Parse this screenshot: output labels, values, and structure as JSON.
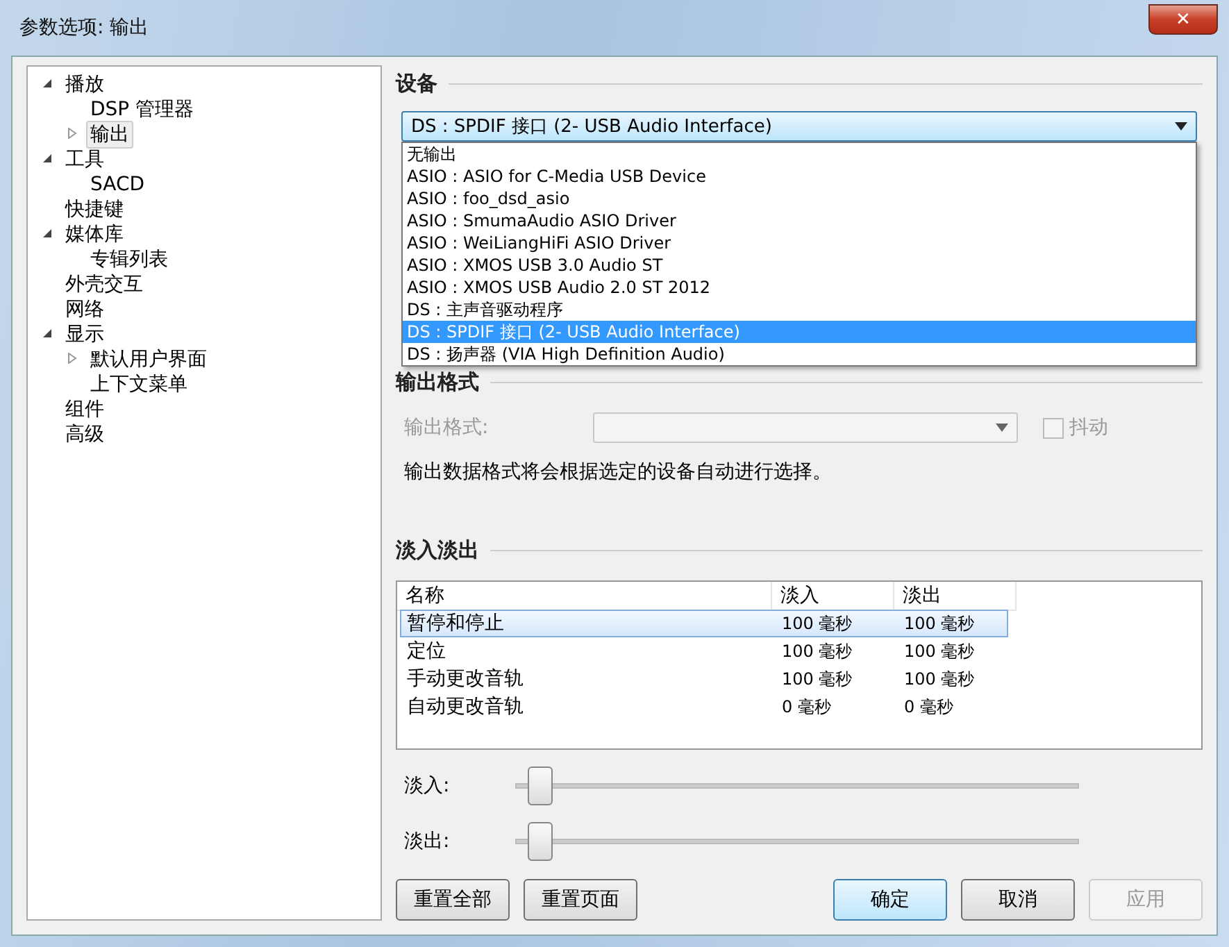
{
  "window": {
    "title": "参数选项: 输出",
    "close": "✕"
  },
  "tree": [
    {
      "label": "播放",
      "expanded": true,
      "selected": false,
      "children": [
        {
          "label": "DSP 管理器",
          "selected": false
        },
        {
          "label": "输出",
          "expanded": false,
          "selected": true
        }
      ]
    },
    {
      "label": "工具",
      "expanded": true,
      "selected": false,
      "children": [
        {
          "label": "SACD",
          "selected": false
        }
      ]
    },
    {
      "label": "快捷键",
      "selected": false
    },
    {
      "label": "媒体库",
      "expanded": true,
      "selected": false,
      "children": [
        {
          "label": "专辑列表",
          "selected": false
        }
      ]
    },
    {
      "label": "外壳交互",
      "selected": false
    },
    {
      "label": "网络",
      "selected": false
    },
    {
      "label": "显示",
      "expanded": true,
      "selected": false,
      "children": [
        {
          "label": "默认用户界面",
          "expanded": false,
          "selected": false
        },
        {
          "label": "上下文菜单",
          "selected": false
        }
      ]
    },
    {
      "label": "组件",
      "selected": false
    },
    {
      "label": "高级",
      "selected": false
    }
  ],
  "device": {
    "heading": "设备",
    "value": "DS : SPDIF 接口 (2- USB Audio Interface)",
    "options": [
      {
        "label": "无输出",
        "selected": false
      },
      {
        "label": "ASIO : ASIO for C-Media USB Device",
        "selected": false
      },
      {
        "label": "ASIO : foo_dsd_asio",
        "selected": false
      },
      {
        "label": "ASIO : SmumaAudio ASIO Driver",
        "selected": false
      },
      {
        "label": "ASIO : WeiLiangHiFi ASIO Driver",
        "selected": false
      },
      {
        "label": "ASIO : XMOS USB 3.0 Audio ST",
        "selected": false
      },
      {
        "label": "ASIO : XMOS USB Audio 2.0 ST 2012",
        "selected": false
      },
      {
        "label": "DS : 主声音驱动程序",
        "selected": false
      },
      {
        "label": "DS : SPDIF 接口 (2- USB Audio Interface)",
        "selected": true
      },
      {
        "label": "DS : 扬声器 (VIA High Definition Audio)",
        "selected": false
      }
    ]
  },
  "output_format": {
    "heading": "输出格式",
    "label": "输出格式:",
    "disabled": true,
    "dither": {
      "label": "抖动",
      "checked": false,
      "disabled": true
    },
    "note": "输出数据格式将会根据选定的设备自动进行选择。"
  },
  "fade": {
    "heading": "淡入淡出",
    "columns": [
      "名称",
      "淡入",
      "淡出"
    ],
    "rows": [
      {
        "cells": [
          "暂停和停止",
          "100 毫秒",
          "100 毫秒"
        ],
        "selected": true
      },
      {
        "cells": [
          "定位",
          "100 毫秒",
          "100 毫秒"
        ],
        "selected": false
      },
      {
        "cells": [
          "手动更改音轨",
          "100 毫秒",
          "100 毫秒"
        ],
        "selected": false
      },
      {
        "cells": [
          "自动更改音轨",
          "0 毫秒",
          "0 毫秒"
        ],
        "selected": false
      }
    ],
    "sliders": [
      {
        "label": "淡入:",
        "level": 0.02
      },
      {
        "label": "淡出:",
        "level": 0.02
      }
    ]
  },
  "buttons": [
    {
      "label": "重置全部",
      "kind": "left",
      "disabled": false
    },
    {
      "label": "重置页面",
      "kind": "left",
      "disabled": false
    },
    {
      "label": "确定",
      "kind": "default",
      "disabled": false
    },
    {
      "label": "取消",
      "kind": "right",
      "disabled": false
    },
    {
      "label": "应用",
      "kind": "right",
      "disabled": true
    }
  ]
}
